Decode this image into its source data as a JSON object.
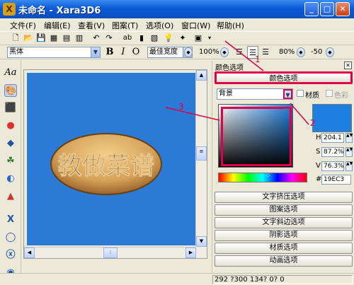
{
  "window": {
    "title": "未命名 - Xara3D6"
  },
  "menu": [
    {
      "label": "文件(F)"
    },
    {
      "label": "编辑(E)"
    },
    {
      "label": "查看(V)"
    },
    {
      "label": "图案(T)"
    },
    {
      "label": "选项(O)"
    },
    {
      "label": "窗口(W)"
    },
    {
      "label": "帮助(H)"
    }
  ],
  "format_bar": {
    "font": "黑体",
    "bold": "B",
    "italic": "I",
    "outline": "O",
    "width_mode": "最佳宽度",
    "zoom": "100%",
    "spacing": "80%",
    "offset": "-50"
  },
  "canvas": {
    "artwork_text": "教做菜谱",
    "background_color": "#2a7ad6",
    "stone_color": "#d7a25a"
  },
  "panel": {
    "title": "颜色选项",
    "color_options_button": "颜色选项",
    "target": "背景",
    "material_label": "材质",
    "color_label": "色彩",
    "h_label": "H",
    "h_value": "204.1",
    "s_label": "S",
    "s_value": "87.2%",
    "v_label": "V",
    "v_value": "76.3%",
    "hex_label": "#",
    "hex_value": "19EC3",
    "current_color": "#1d7fe0",
    "sections": [
      {
        "label": "文字挤压选项"
      },
      {
        "label": "图案选项"
      },
      {
        "label": "文字斜边选项"
      },
      {
        "label": "阴影选项"
      },
      {
        "label": "材质选项"
      },
      {
        "label": "动画选项"
      }
    ]
  },
  "status": {
    "text": "292 ?300  134? 0? 0"
  },
  "annotations": [
    {
      "label": "1"
    },
    {
      "label": "2"
    },
    {
      "label": "3"
    }
  ]
}
